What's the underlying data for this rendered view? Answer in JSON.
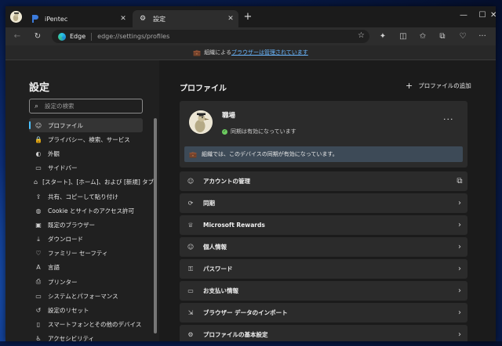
{
  "tabs": [
    {
      "label": "iPentec",
      "close": "✕"
    },
    {
      "label": "設定",
      "close": "✕"
    }
  ],
  "newtab": "+",
  "window_controls": {
    "minimize": "—",
    "maximize": "☐",
    "close": "✕"
  },
  "address": {
    "site": "Edge",
    "url": "edge://settings/profiles"
  },
  "infobar": {
    "prefix": "組織による",
    "link": "ブラウザーは管理されています"
  },
  "sidebar": {
    "title": "設定",
    "search_placeholder": "設定の検索",
    "items": [
      {
        "icon": "profile-icon",
        "label": "プロファイル",
        "active": true
      },
      {
        "icon": "lock-icon",
        "label": "プライバシー、検索、サービス"
      },
      {
        "icon": "appearance-icon",
        "label": "外観"
      },
      {
        "icon": "sidebar-icon",
        "label": "サイドバー"
      },
      {
        "icon": "start-icon",
        "label": "[スタート]、[ホーム]、および [新規] タブ"
      },
      {
        "icon": "share-icon",
        "label": "共有、コピーして貼り付け"
      },
      {
        "icon": "cookie-icon",
        "label": "Cookie とサイトのアクセス許可"
      },
      {
        "icon": "browser-icon",
        "label": "既定のブラウザー"
      },
      {
        "icon": "download-icon",
        "label": "ダウンロード"
      },
      {
        "icon": "family-icon",
        "label": "ファミリー セーフティ"
      },
      {
        "icon": "language-icon",
        "label": "言語"
      },
      {
        "icon": "printer-icon",
        "label": "プリンター"
      },
      {
        "icon": "system-icon",
        "label": "システムとパフォーマンス"
      },
      {
        "icon": "reset-icon",
        "label": "設定のリセット"
      },
      {
        "icon": "phone-icon",
        "label": "スマートフォンとその他のデバイス"
      },
      {
        "icon": "accessibility-icon",
        "label": "アクセシビリティ"
      }
    ]
  },
  "main": {
    "title": "プロファイル",
    "add_profile": "プロファイルの追加",
    "profile": {
      "name": "職場",
      "sync_status": "同期は有効になっています",
      "more": "···",
      "org_notice": "組織では、このデバイスの同期が有効になっています。"
    },
    "rows": [
      {
        "icon": "person-icon",
        "label": "アカウントの管理",
        "trail": "⧉"
      },
      {
        "icon": "sync-icon",
        "label": "同期",
        "trail": "›"
      },
      {
        "icon": "rewards-icon",
        "label": "Microsoft Rewards",
        "trail": "›"
      },
      {
        "icon": "personal-info-icon",
        "label": "個人情報",
        "trail": "›"
      },
      {
        "icon": "key-icon",
        "label": "パスワード",
        "trail": "›"
      },
      {
        "icon": "card-icon",
        "label": "お支払い情報",
        "trail": "›"
      },
      {
        "icon": "import-icon",
        "label": "ブラウザー データのインポート",
        "trail": "›"
      },
      {
        "icon": "profile-settings-icon",
        "label": "プロファイルの基本設定",
        "trail": "›"
      }
    ]
  },
  "colors": {
    "accent": "#4cc2ff",
    "link": "#6ab7ff",
    "sync_ok": "#6ccb5f"
  }
}
